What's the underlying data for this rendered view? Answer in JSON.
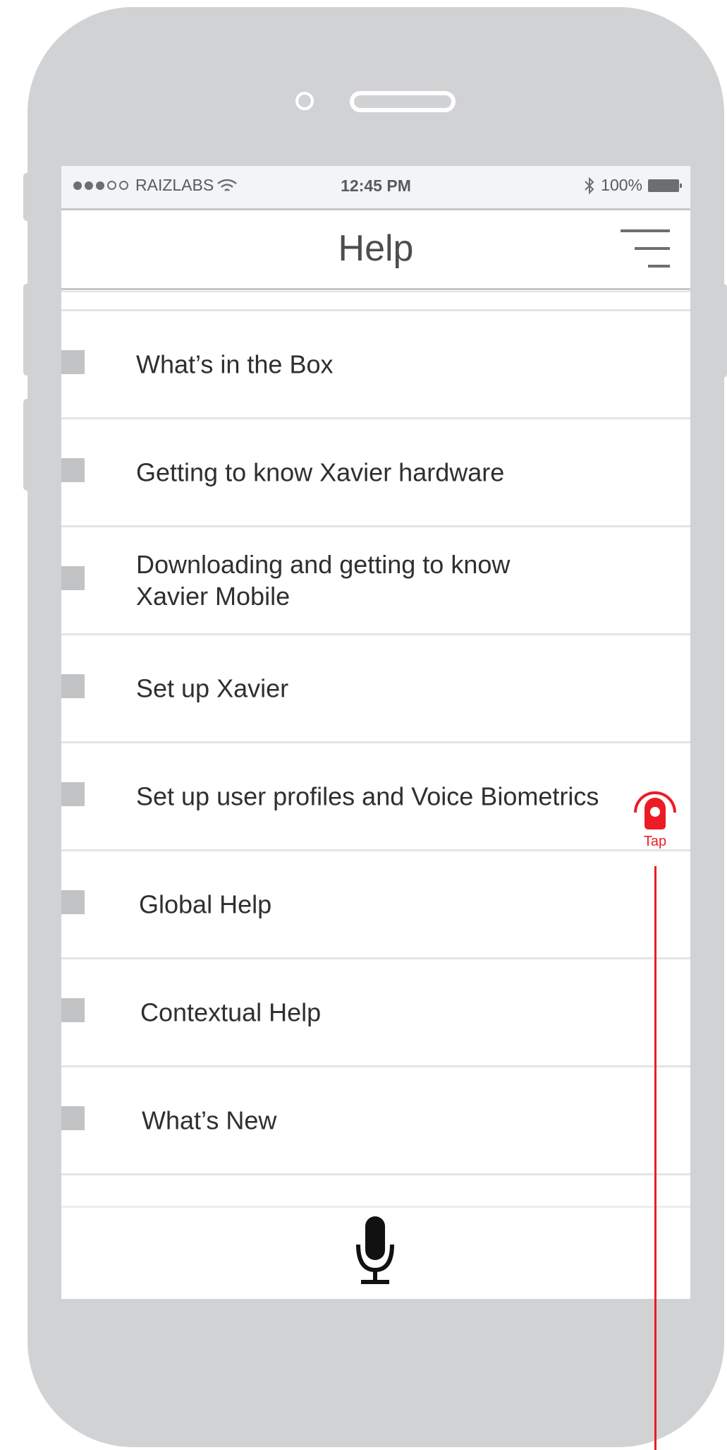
{
  "status_bar": {
    "carrier": "RAIZLABS",
    "time": "12:45 PM",
    "battery": "100%",
    "signal_dots": 5,
    "signal_filled": 3
  },
  "nav": {
    "title": "Help",
    "menu_icon": "hamburger-menu-icon"
  },
  "help_items": [
    "What’s in the Box",
    "Getting to know Xavier hardware",
    "Downloading and getting to know Xavier Mobile",
    "Set up Xavier",
    "Set up user profiles and Voice Biometrics",
    "Global Help",
    "Contextual Help",
    "What’s New"
  ],
  "bottom_bar": {
    "mic_icon": "microphone-icon"
  },
  "annotation": {
    "label": "Tap",
    "color": "#ec1c24"
  },
  "colors": {
    "device_frame": "#d1d2d4",
    "status_bar_bg": "#f3f4f6",
    "divider": "#e3e4e6",
    "marker": "#c2c3c5"
  }
}
